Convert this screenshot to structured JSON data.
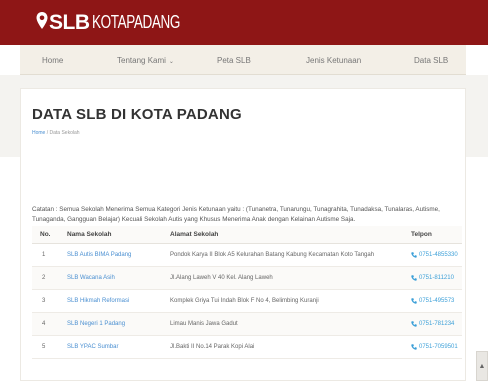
{
  "brand": {
    "primary": "SLB",
    "city": "KOTAPADANG",
    "accent_color": "#8e1616"
  },
  "nav": {
    "items": [
      {
        "label": "Home"
      },
      {
        "label": "Tentang Kami",
        "dropdown": true
      },
      {
        "label": "Peta SLB"
      },
      {
        "label": "Jenis Ketunaan"
      },
      {
        "label": "Data SLB"
      }
    ]
  },
  "page": {
    "title": "DATA SLB DI KOTA PADANG",
    "breadcrumb_home": "Home",
    "breadcrumb_sep": "/",
    "breadcrumb_current": "Data Sekolah"
  },
  "note": "Catatan : Semua Sekolah Menerima Semua Kategori Jenis Ketunaan yaitu : (Tunanetra, Tunarungu, Tunagrahita, Tunadaksa, Tunalaras, Autisme, Tunaganda, Gangguan Belajar) Kecuali Sekolah Autis yang Khusus Menerima Anak dengan Kelainan Autisme Saja.",
  "table": {
    "headers": {
      "no": "No.",
      "name": "Nama Sekolah",
      "address": "Alamat Sekolah",
      "phone": "Telpon"
    },
    "rows": [
      {
        "no": "1",
        "name": "SLB Autis BIMA Padang",
        "address": "Pondok Karya II Blok A5 Kelurahan Batang Kabung Kecamatan Koto Tangah",
        "phone": "0751-4855330"
      },
      {
        "no": "2",
        "name": "SLB Wacana Asih",
        "address": "Jl.Alang Laweh V 40 Kel. Alang Laweh",
        "phone": "0751-811210"
      },
      {
        "no": "3",
        "name": "SLB Hikmah Reformasi",
        "address": "Komplek Griya Tui Indah Blok F No 4, Belimbing Kuranji",
        "phone": "0751-495573"
      },
      {
        "no": "4",
        "name": "SLB Negeri 1 Padang",
        "address": "Limau Manis Jawa Gadut",
        "phone": "0751-781234"
      },
      {
        "no": "5",
        "name": "SLB YPAC Sumbar",
        "address": "Jl.Bakti II No.14 Parak Kopi Alai",
        "phone": "0751-7059501"
      }
    ]
  },
  "scroll_top_icon": "chevron-up-icon"
}
